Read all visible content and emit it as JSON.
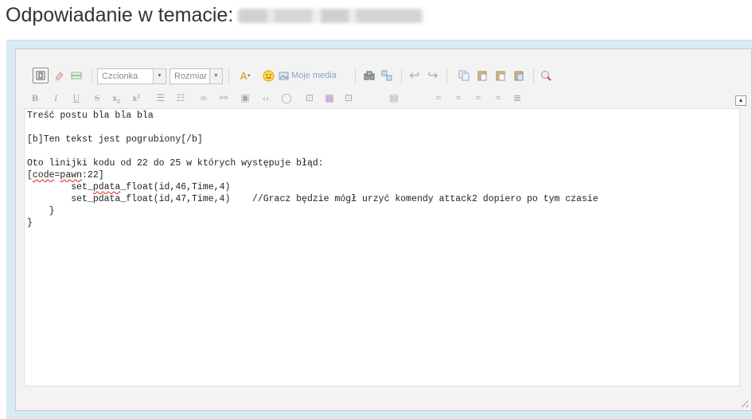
{
  "page": {
    "title": "Odpowiadanie w temacie:"
  },
  "toolbar": {
    "font_combo": "Czcionka",
    "size_combo": "Rozmiar",
    "media_label": "Moje media"
  },
  "formatting": [
    "B",
    "I",
    "U",
    "S",
    "x₂",
    "x²"
  ],
  "editor": {
    "lines": [
      "Treść postu bla bla bla",
      "",
      "[b]Ten tekst jest pogrubiony[/b]",
      "",
      "Oto linijki kodu od 22 do 25 w których występuje błąd:",
      "[code=pawn:22]",
      "        set_pdata_float(id,46,Time,4)",
      "        set_pdata_float(id,47,Time,4)    //Gracz będzie mógł urzyć komendy attack2 dopiero po tym czasie",
      "    }",
      "}"
    ]
  },
  "icons": {
    "source": "source-view-icon",
    "eraser": "eraser-icon",
    "hr": "horizontal-rule-icon",
    "color": "text-color-icon",
    "smiley": "smiley-icon",
    "media": "media-icon",
    "find": "find-icon",
    "replace": "replace-icon",
    "undo": "undo-icon",
    "redo": "redo-icon",
    "copy": "copy-icon",
    "paste": "paste-icon",
    "paste_text": "paste-text-icon",
    "paste_word": "paste-word-icon",
    "spellcheck": "spellcheck-icon"
  },
  "colors": {
    "frame": "#d7ebf5",
    "editor_bg": "#f3f3f3",
    "icon": "#8fa9c2"
  }
}
